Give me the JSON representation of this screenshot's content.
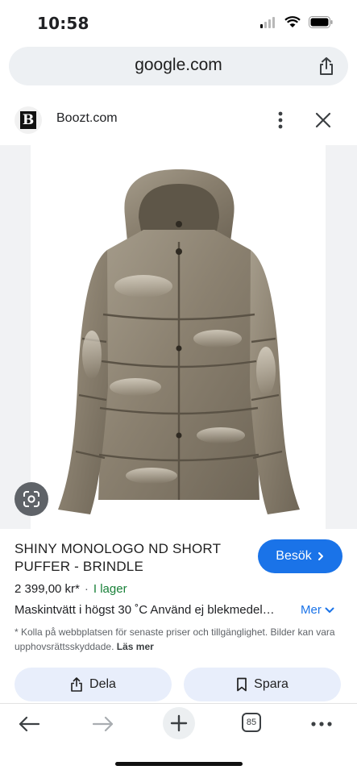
{
  "status": {
    "time": "10:58"
  },
  "browser": {
    "url": "google.com"
  },
  "site": {
    "logo_letter": "B",
    "name": "Boozt.com"
  },
  "product": {
    "title": "SHINY MONOLOGO ND SHORT PUFFER - BRINDLE",
    "price": "2 399,00 kr*",
    "stock": "I lager",
    "description": "Maskintvätt i högst 30 ˚C Använd ej blekmedel…",
    "more_label": "Mer",
    "disclaimer_text": "* Kolla på webbplatsen för senaste priser och tillgänglighet. Bilder kan vara upphovsrättsskyddade.",
    "disclaimer_link": "Läs mer",
    "visit_label": "Besök"
  },
  "actions": {
    "share_label": "Dela",
    "save_label": "Spara"
  },
  "nav": {
    "tabs_count": "85"
  },
  "colors": {
    "accent": "#1a73e8",
    "stock": "#188038",
    "jacket": "#8b8170"
  }
}
